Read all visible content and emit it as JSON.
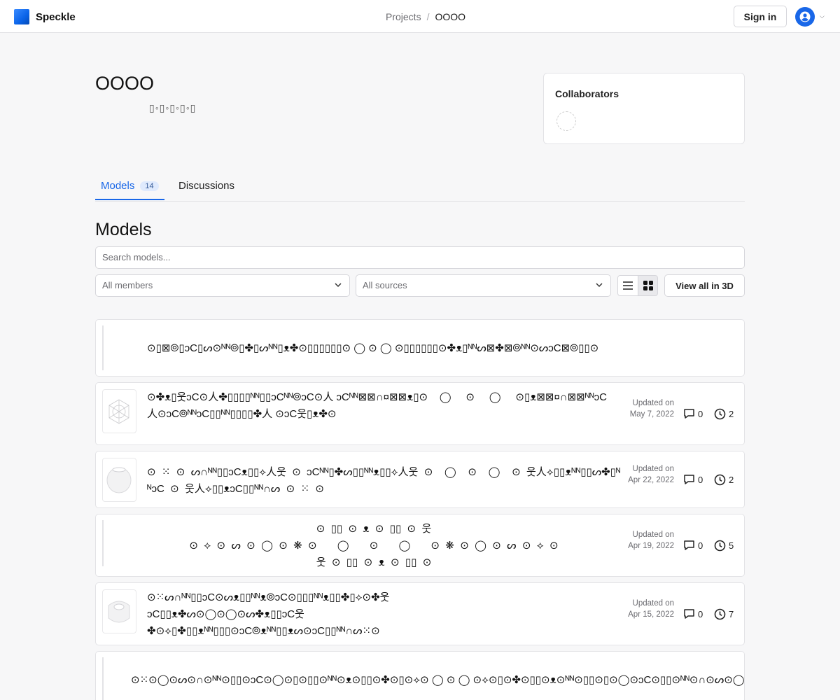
{
  "header": {
    "brand": "Speckle",
    "breadcrumb": {
      "projects": "Projects",
      "separator": "/",
      "current": "OOOO"
    },
    "sign_in": "Sign in"
  },
  "project": {
    "title": "OOOO",
    "subtitle": "▯◦▯◦▯◦▯◦▯",
    "collaborators_label": "Collaborators"
  },
  "tabs": {
    "models_label": "Models",
    "models_count": "14",
    "discussions_label": "Discussions"
  },
  "models_section": {
    "heading": "Models",
    "search_placeholder": "Search models...",
    "members_filter": "All members",
    "sources_filter": "All sources",
    "view_all": "View all in 3D"
  },
  "models": [
    {
      "name": "⊙▯⊠⦾▯ɔϹ▯ᔕ⊙ᴺᴺ⦾▯✤▯ᔕᴺᴺ▯ᴥ✤⊙▯▯▯▯▯▯⊙      ◯       ⊙       ◯       ⊙▯▯▯▯▯▯⊙✤ᴥ▯ᴺᴺᔕ⊠✤⊠⦾ᴺᴺ⊙ᔕɔϹ⊠⦾▯▯⊙",
      "updated": "",
      "comments": "",
      "versions": ""
    },
    {
      "name": "⊙✤ᴥ▯웃ɔϹ⊙人✤▯▯▯▯ᴺᴺ▯▯ɔϹᴺᴺ⦾ɔϹ⊙人 ɔϹᴺᴺ⊠⊠∩¤⊠⊠ᴥ▯⊙    ◯     ⊙     ◯     ⊙▯ᴥ⊠⊠¤∩⊠⊠ᴺᴺɔϹ人⊙ɔϹ⦾ᴺᴺɔϹ▯▯ᴺᴺ▯▯▯▯✤人 ⊙ɔϹ웃▯ᴥ✤⊙",
      "updated": "Updated on May 7, 2022",
      "comments": "0",
      "versions": "2"
    },
    {
      "name": "⊙  ⁙  ⊙  ᔕ∩ᴺᴺ▯▯ɔϹᴥ▯▯⟡人웃  ⊙  ɔϹᴺᴺ▯✤ᔕ▯▯ᴺᴺᴥ▯▯⟡人웃  ⊙    ◯    ⊙    ◯    ⊙  웃人⟡▯▯ᴥᴺᴺ▯▯ᔕ✤▯ᴺᴺɔϹ  ⊙  웃人⟡▯▯ᴥɔϹ▯▯ᴺᴺ∩ᔕ  ⊙  ⁙  ⊙",
      "updated": "Updated on Apr 22, 2022",
      "comments": "0",
      "versions": "2"
    },
    {
      "name": "⊙  ▯▯  ⊙  ᴥ  ⊙  ▯▯  ⊙  웃\n⊙  ⟡  ⊙  ᔕ  ⊙  ◯  ⊙  ❋  ⊙       ◯       ⊙       ◯       ⊙  ❋  ⊙  ◯  ⊙  ᔕ  ⊙  ⟡  ⊙\n웃  ⊙  ▯▯  ⊙  ᴥ  ⊙  ▯▯  ⊙",
      "updated": "Updated on Apr 19, 2022",
      "comments": "0",
      "versions": "5"
    },
    {
      "name": "⊙⁙ᔕ∩ᴺᴺ▯▯ɔϹ⊙ᔕᴥ▯▯ᴺᴺᴥ⦾ɔϹ⊙▯▯▯ᴺᴺᴥ▯▯✤▯⟡⊙✤웃\nɔϹ▯▯ᴥ✤ᔕ⊙◯⊙◯⊙ᔕ✤ᴥ▯▯ɔϹ웃\n✤⊙⟡▯✤▯▯ᴥᴺᴺ▯▯▯⊙ɔϹ⦾ᴥᴺᴺ▯▯ᴥᔕ⊙ɔϹ▯▯ᴺᴺ∩ᔕ⁙⊙",
      "updated": "Updated on Apr 15, 2022",
      "comments": "0",
      "versions": "7"
    },
    {
      "name": "⊙⁙⊙◯⊙ᔕ⊙∩⊙ᴺᴺ⊙▯▯⊙ɔϹ⊙◯⊙▯⊙▯▯⊙ᴺᴺ⊙ᴥ⊙▯▯⊙✤⊙▯⊙⟡⊙    ◯     ⊙     ◯     ⊙⟡⊙▯⊙✤⊙▯▯⊙ᴥ⊙ᴺᴺ⊙▯▯⊙▯⊙◯⊙ɔϹ⊙▯▯⊙ᴺᴺ⊙∩⊙ᔕ⊙◯⊙⁙⊙",
      "updated": "",
      "comments": "",
      "versions": ""
    }
  ],
  "colors": {
    "accent": "#1967e8",
    "badge_bg": "#dfeafd"
  }
}
